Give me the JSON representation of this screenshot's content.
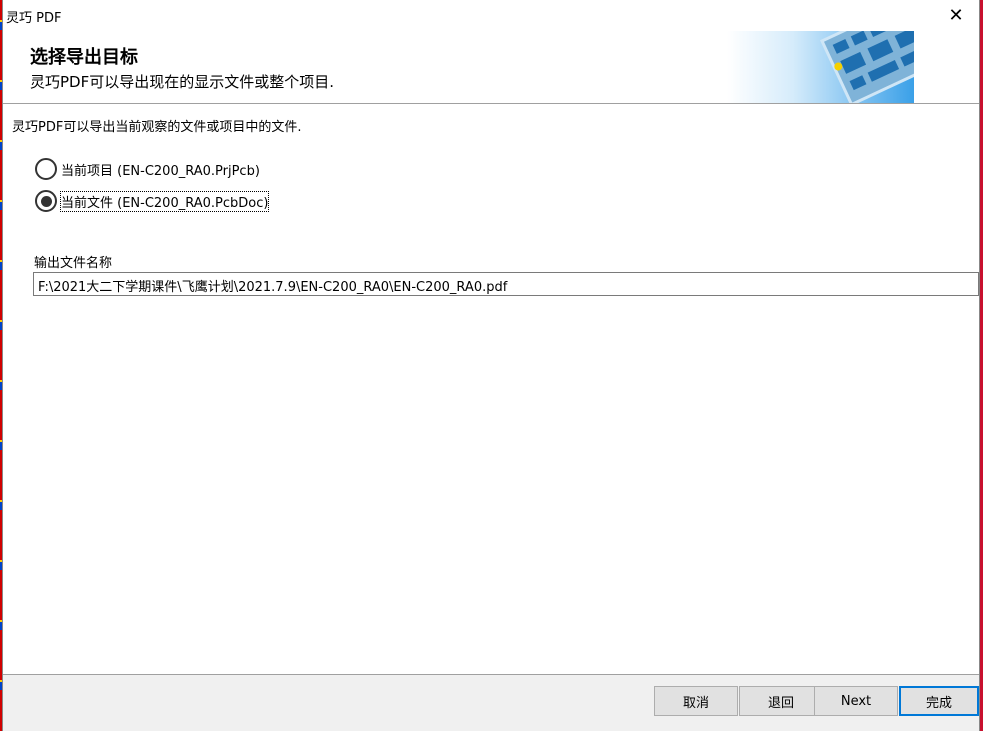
{
  "window": {
    "title": "灵巧 PDF",
    "close_glyph": "✕"
  },
  "header": {
    "title": "选择导出目标",
    "subtitle": "灵巧PDF可以导出现在的显示文件或整个项目."
  },
  "content": {
    "description": "灵巧PDF可以导出当前观察的文件或项目中的文件.",
    "options": [
      {
        "label": "当前项目 (EN-C200_RA0.PrjPcb)",
        "selected": false
      },
      {
        "label": "当前文件 (EN-C200_RA0.PcbDoc)",
        "selected": true
      }
    ],
    "output_label": "输出文件名称",
    "output_value": "F:\\2021大二下学期课件\\飞鹰计划\\2021.7.9\\EN-C200_RA0\\EN-C200_RA0.pdf"
  },
  "footer": {
    "cancel": "取消",
    "back": "退回",
    "next": "Next",
    "finish": "完成"
  },
  "colors": {
    "accent": "#0078d7",
    "background": "#c8102e"
  }
}
